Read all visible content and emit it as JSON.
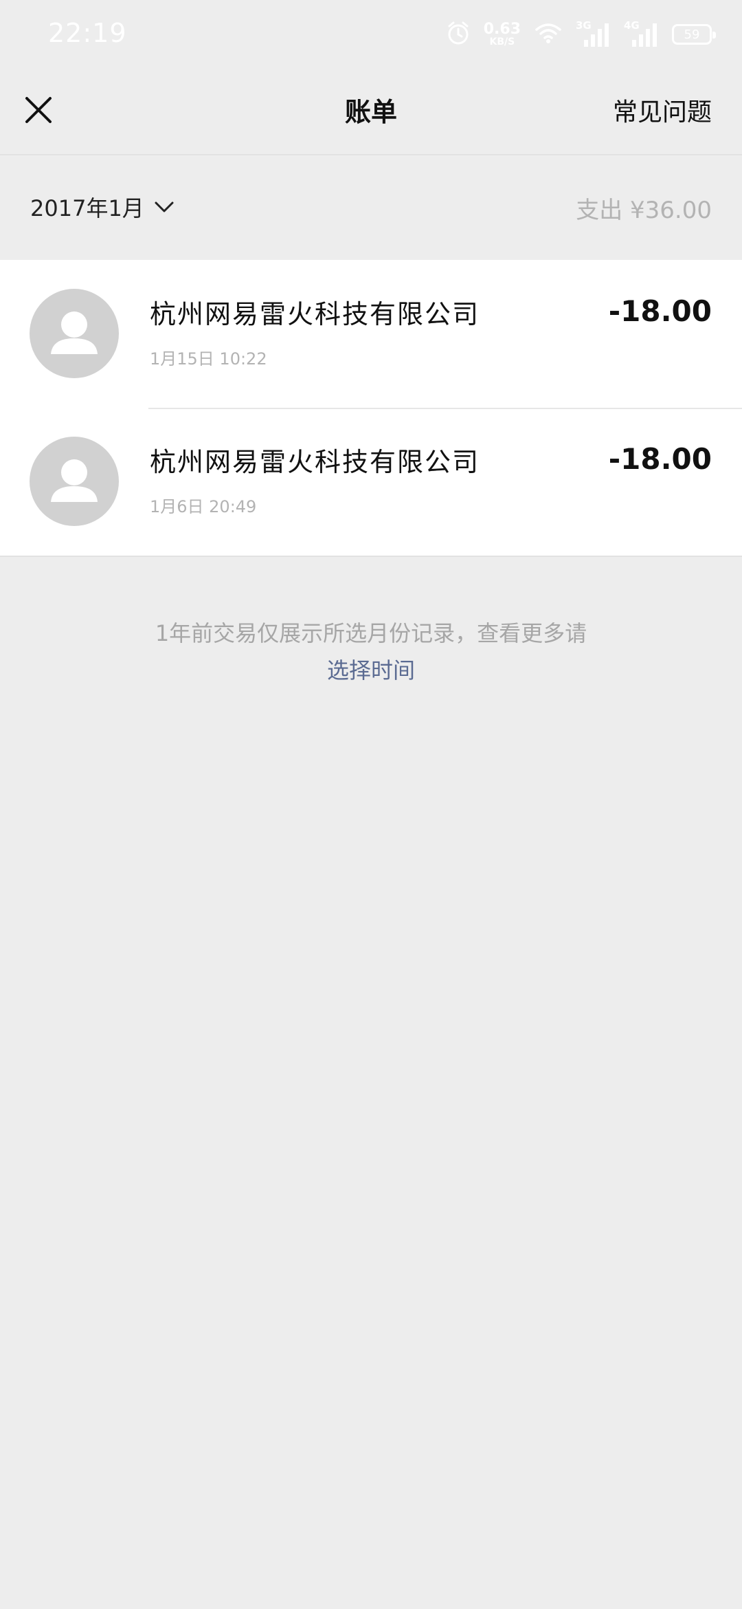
{
  "status_bar": {
    "time": "22:19",
    "net_speed_value": "0.63",
    "net_speed_unit": "KB/S",
    "net_3g": "3G",
    "net_4g": "4G",
    "battery": "59"
  },
  "nav": {
    "title": "账单",
    "faq_label": "常见问题"
  },
  "filter": {
    "month": "2017年1月",
    "expense_summary": "支出 ¥36.00"
  },
  "transactions": [
    {
      "merchant": "杭州网易雷火科技有限公司",
      "time": "1月15日 10:22",
      "amount": "-18.00"
    },
    {
      "merchant": "杭州网易雷火科技有限公司",
      "time": "1月6日 20:49",
      "amount": "-18.00"
    }
  ],
  "footer": {
    "note": "1年前交易仅展示所选月份记录，查看更多请",
    "link": "选择时间"
  },
  "colors": {
    "background": "#ededed",
    "card": "#ffffff",
    "link": "#5b6b92",
    "muted": "#b3b3b3",
    "avatar": "#d1d1d1"
  }
}
